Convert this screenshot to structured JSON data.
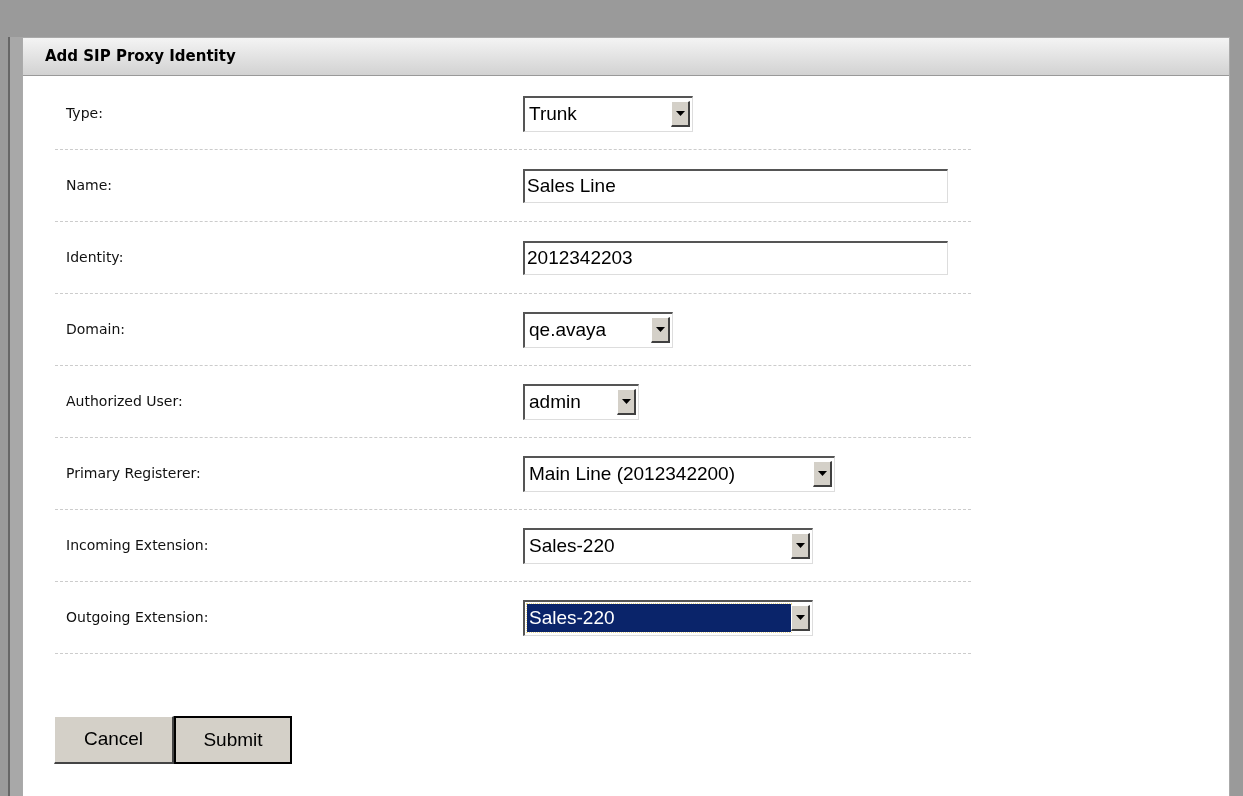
{
  "panel": {
    "title": "Add SIP Proxy Identity"
  },
  "fields": [
    {
      "label": "Type:",
      "kind": "select",
      "value": "Trunk",
      "focused": false
    },
    {
      "label": "Name:",
      "kind": "text",
      "value": "Sales Line",
      "focused": false
    },
    {
      "label": "Identity:",
      "kind": "text",
      "value": "2012342203",
      "focused": false
    },
    {
      "label": "Domain:",
      "kind": "select",
      "value": "qe.avaya",
      "focused": false
    },
    {
      "label": "Authorized User:",
      "kind": "select",
      "value": "admin",
      "focused": false
    },
    {
      "label": "Primary Registerer:",
      "kind": "select",
      "value": "Main Line (2012342200)",
      "focused": false
    },
    {
      "label": "Incoming Extension:",
      "kind": "select",
      "value": "Sales-220",
      "focused": false
    },
    {
      "label": "Outgoing Extension:",
      "kind": "select",
      "value": "Sales-220",
      "focused": true
    }
  ],
  "buttons": [
    {
      "label": "Cancel",
      "default": false
    },
    {
      "label": "Submit",
      "default": true
    }
  ]
}
